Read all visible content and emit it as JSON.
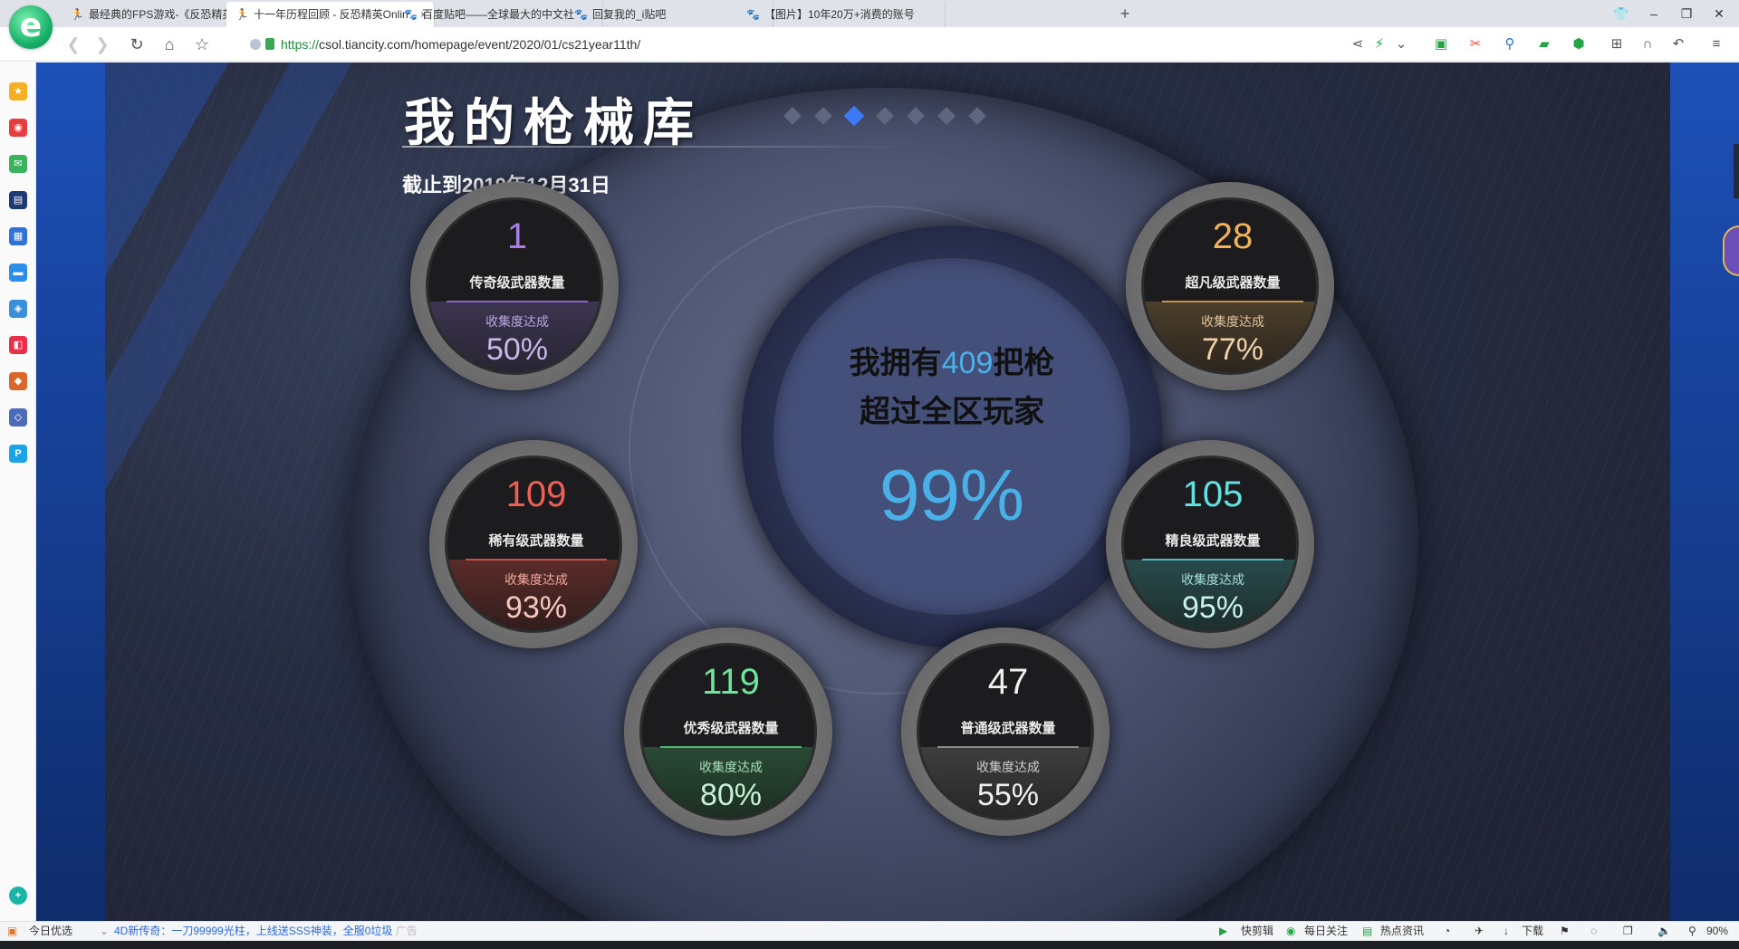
{
  "browser": {
    "logo_letter": "e",
    "tabs": [
      {
        "title": "最经典的FPS游戏-《反恐精英On",
        "icon": "cs-figure-icon",
        "active": false
      },
      {
        "title": "十一年历程回顾 - 反恐精英Onlin",
        "icon": "cs-figure-icon",
        "active": true,
        "close": "×"
      },
      {
        "title": "百度贴吧——全球最大的中文社",
        "icon": "baidu-paw-icon",
        "active": false
      },
      {
        "title": "回复我的_i贴吧",
        "icon": "baidu-paw-icon",
        "active": false
      },
      {
        "title": "【图片】10年20万+消费的账号",
        "icon": "baidu-paw-icon",
        "active": false
      }
    ],
    "new_tab": "+",
    "url_scheme": "https://",
    "url_rest": "csol.tiancity.com/homepage/event/2020/01/cs21year11th/"
  },
  "page": {
    "title": "我的枪械库",
    "date": "截止到2019年12月31日",
    "center": {
      "prefix": "我拥有",
      "count": "409",
      "suffix": "把枪",
      "line2": "超过全区玩家",
      "percent": "99%"
    },
    "collect_label": "收集度达成",
    "stats": {
      "legendary": {
        "value": "1",
        "label": "传奇级武器数量",
        "percent": "50%"
      },
      "extraordinary": {
        "value": "28",
        "label": "超凡级武器数量",
        "percent": "77%"
      },
      "rare": {
        "value": "109",
        "label": "稀有级武器数量",
        "percent": "93%"
      },
      "elite": {
        "value": "105",
        "label": "精良级武器数量",
        "percent": "95%"
      },
      "excellent": {
        "value": "119",
        "label": "优秀级武器数量",
        "percent": "80%"
      },
      "common": {
        "value": "47",
        "label": "普通级武器数量",
        "percent": "55%"
      }
    },
    "pagination": {
      "count": 7,
      "active_index": 2
    }
  },
  "statusbar": {
    "today": "今日优选",
    "news": "4D新传奇：一刀99999光柱，上线送SSS神装，全服0垃圾",
    "news_tag": "广告",
    "clip": "快剪辑",
    "daily": "每日关注",
    "hot": "热点资讯",
    "download": "下载",
    "zoom": "90%"
  },
  "colors": {
    "accent_blue": "#4ab0e8",
    "legendary": "#a87de6",
    "extraordinary": "#f2b25a",
    "rare": "#ef5f55",
    "elite": "#63e0e0",
    "excellent": "#6ee59b",
    "common": "#f0f0f0"
  }
}
